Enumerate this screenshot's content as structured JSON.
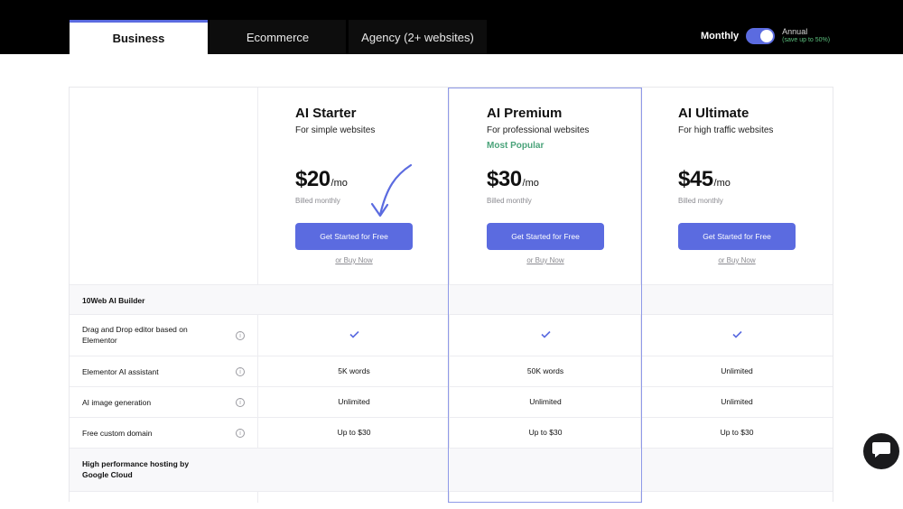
{
  "tabs": [
    {
      "label": "Business",
      "active": true
    },
    {
      "label": "Ecommerce",
      "active": false
    },
    {
      "label": "Agency (2+ websites)",
      "active": false
    }
  ],
  "billing": {
    "monthly_label": "Monthly",
    "annual_label": "Annual",
    "annual_note": "(save up to 50%)",
    "toggle_state": "monthly"
  },
  "plans": [
    {
      "name": "AI Starter",
      "description": "For simple websites",
      "badge": "",
      "price": "$20",
      "period": "/mo",
      "billed": "Billed monthly",
      "cta": "Get Started for Free",
      "buy": "or Buy Now"
    },
    {
      "name": "AI Premium",
      "description": "For professional websites",
      "badge": "Most Popular",
      "price": "$30",
      "period": "/mo",
      "billed": "Billed monthly",
      "cta": "Get Started for Free",
      "buy": "or Buy Now"
    },
    {
      "name": "AI Ultimate",
      "description": "For high traffic websites",
      "badge": "",
      "price": "$45",
      "period": "/mo",
      "billed": "Billed monthly",
      "cta": "Get Started for Free",
      "buy": "or Buy Now"
    }
  ],
  "features": {
    "section1": "10Web AI Builder",
    "rows": [
      {
        "label": "Drag and Drop editor based on Elementor",
        "values": [
          "check",
          "check",
          "check"
        ]
      },
      {
        "label": "Elementor AI assistant",
        "values": [
          "5K words",
          "50K words",
          "Unlimited"
        ]
      },
      {
        "label": "AI image generation",
        "values": [
          "Unlimited",
          "Unlimited",
          "Unlimited"
        ]
      },
      {
        "label": "Free custom domain",
        "values": [
          "Up to $30",
          "Up to $30",
          "Up to $30"
        ]
      }
    ],
    "section2": "High performance hosting by Google Cloud"
  },
  "colors": {
    "accent": "#5b6be0",
    "popular": "#4aa37a",
    "topbar": "#000000"
  },
  "icons": [
    "info-icon",
    "check-icon",
    "arrow-icon",
    "chat-icon"
  ]
}
